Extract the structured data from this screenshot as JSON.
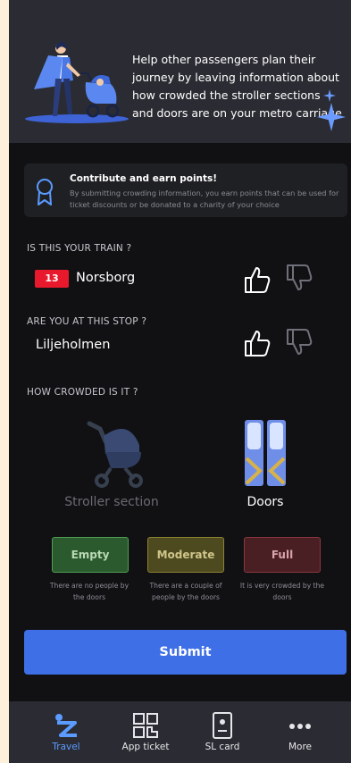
{
  "header": {
    "text": "Help other passengers plan their journey by leaving information about how crowded the stroller sections and doors are on your metro carriage"
  },
  "contribute": {
    "title": "Contribute and earn points!",
    "description": "By submitting crowding information, you earn points that can be used for ticket discounts or be donated to a charity of your choice",
    "icon": "medal-icon"
  },
  "train_question": {
    "label": "IS THIS YOUR TRAIN ?",
    "line_number": "13",
    "destination": "Norsborg",
    "line_color": "#e8192c"
  },
  "stop_question": {
    "label": "ARE YOU AT THIS STOP ?",
    "stop_name": "Liljeholmen"
  },
  "crowding": {
    "label": "HOW CROWDED IS IT ?",
    "options": [
      {
        "label": "Stroller section",
        "icon": "stroller-icon",
        "selected": false
      },
      {
        "label": "Doors",
        "icon": "doors-icon",
        "selected": true
      }
    ],
    "levels": [
      {
        "label": "Empty",
        "description": "There are no people by the doors"
      },
      {
        "label": "Moderate",
        "description": "There are a couple of people by the doors"
      },
      {
        "label": "Full",
        "description": "It is very crowded by the doors"
      }
    ]
  },
  "submit_label": "Submit",
  "nav": {
    "items": [
      {
        "label": "Travel",
        "icon": "travel-icon",
        "active": true
      },
      {
        "label": "App ticket",
        "icon": "qr-ticket-icon",
        "active": false
      },
      {
        "label": "SL card",
        "icon": "sl-card-icon",
        "active": false
      },
      {
        "label": "More",
        "icon": "more-dots-icon",
        "active": false
      }
    ]
  },
  "colors": {
    "accent": "#3f6fe6",
    "nav_active": "#5b9bff",
    "empty": "#4f9e53",
    "moderate": "#8d8232",
    "full": "#8a3840"
  }
}
